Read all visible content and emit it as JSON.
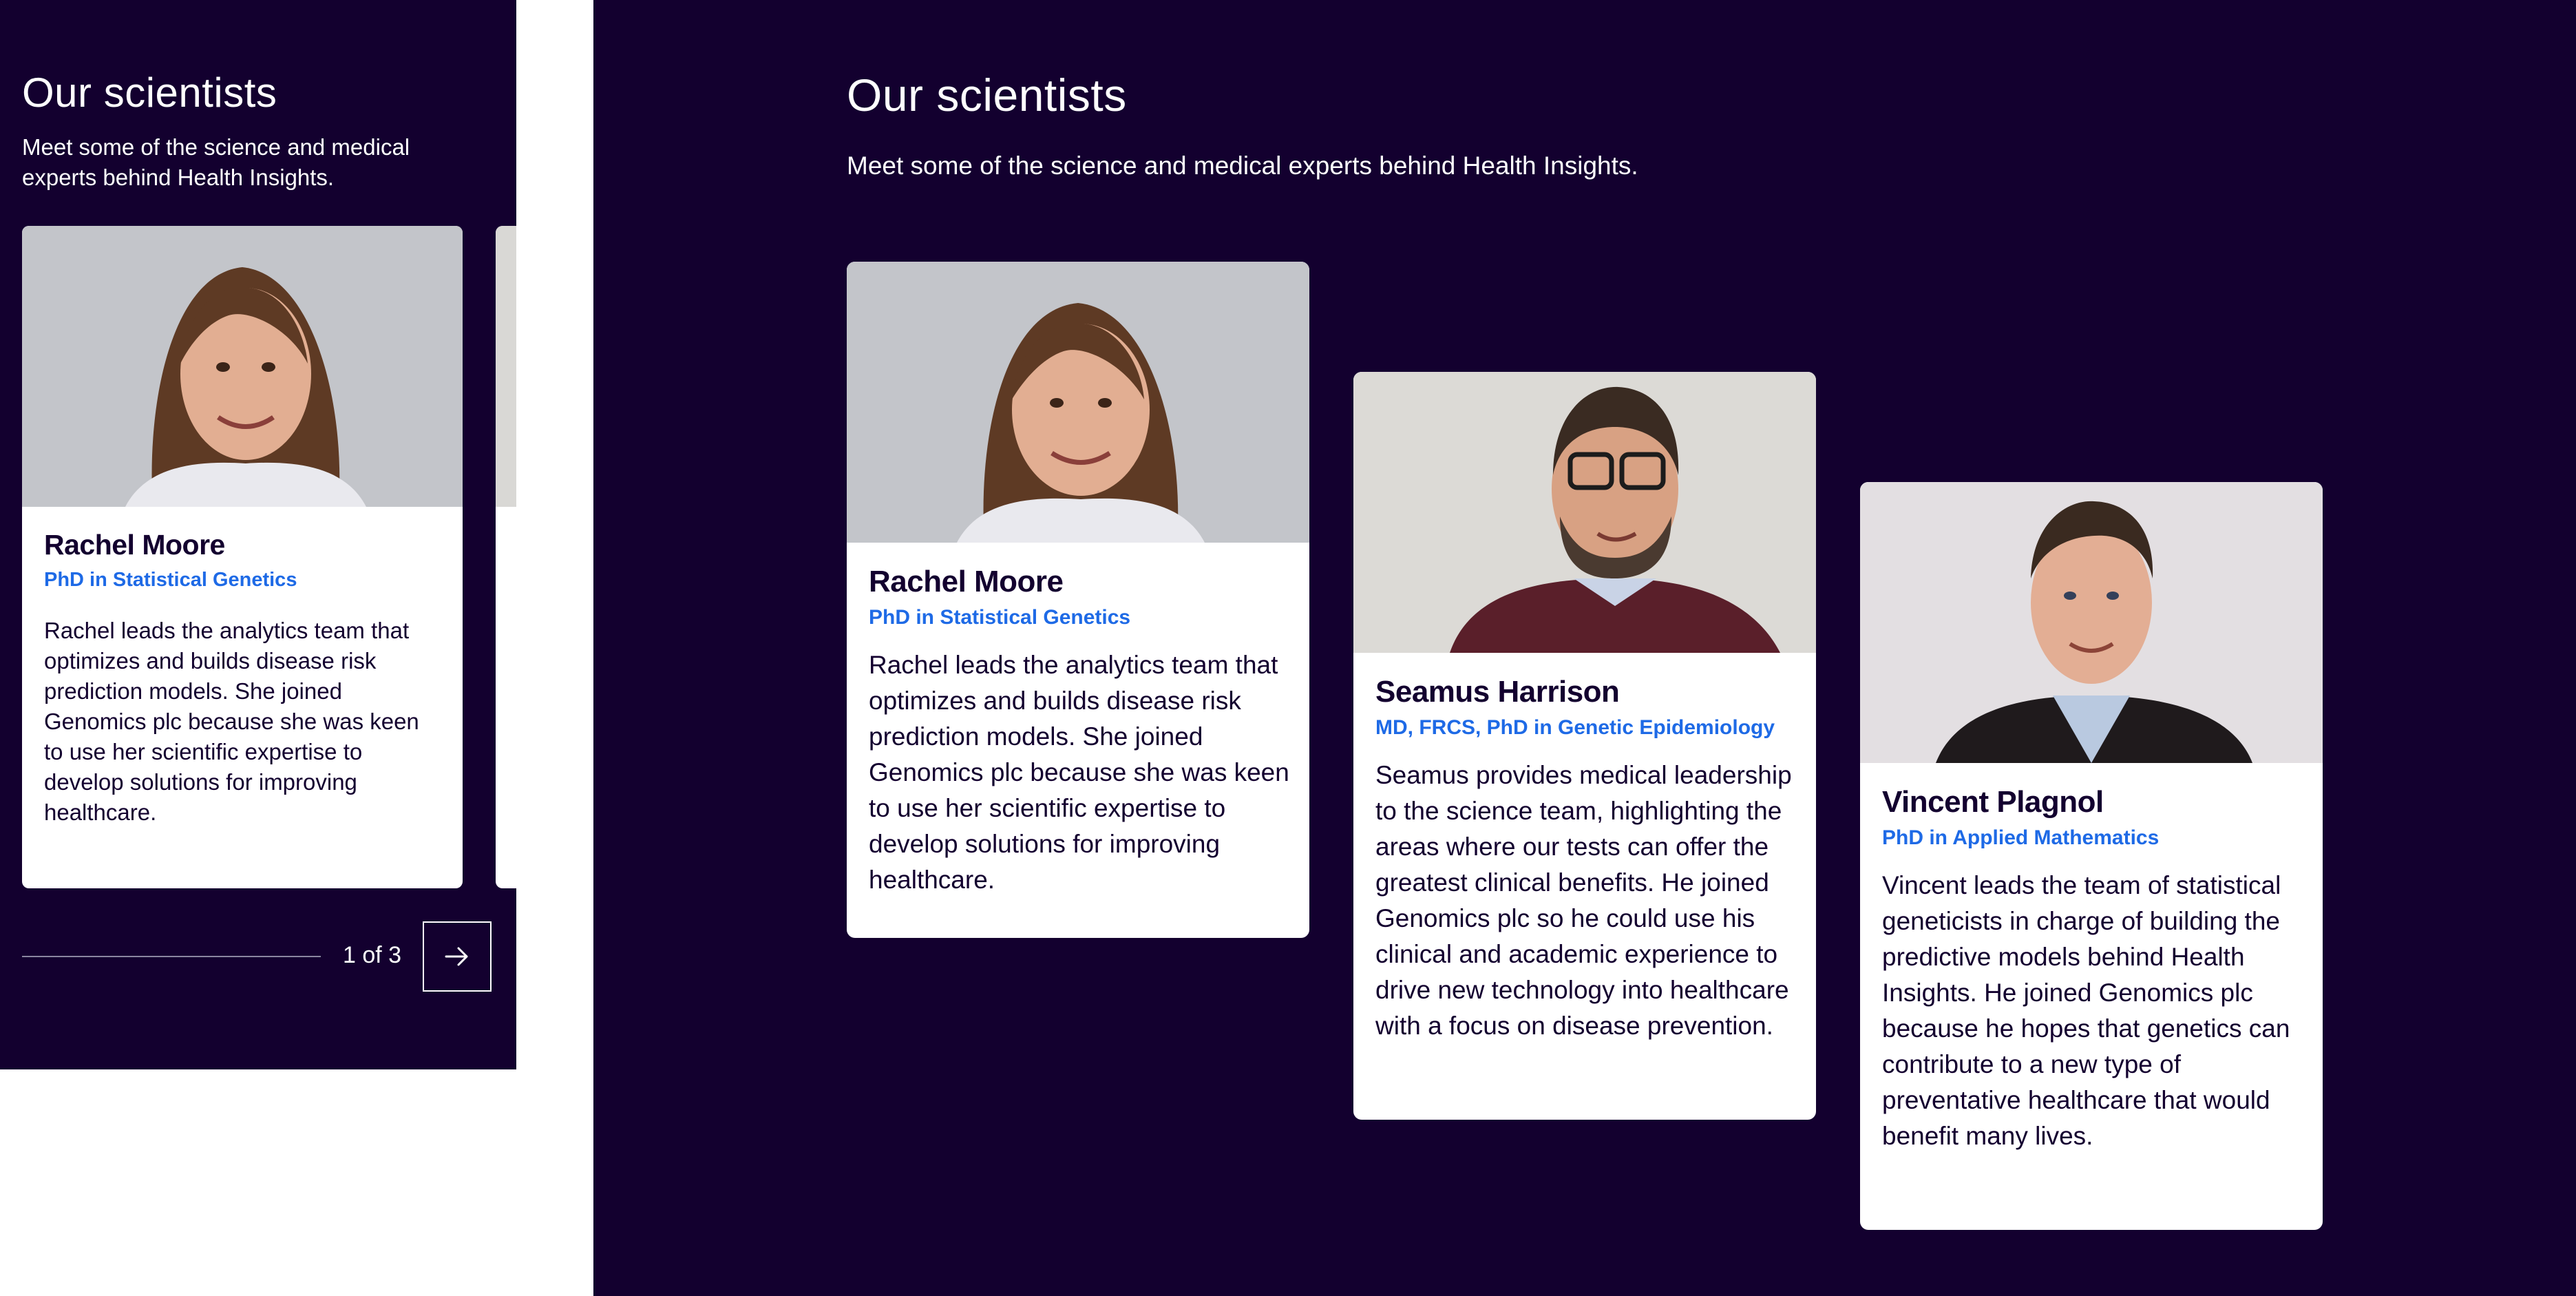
{
  "mobile": {
    "title": "Our scientists",
    "subtitle": "Meet some of the science and medical experts behind Health Insights.",
    "card": {
      "name": "Rachel Moore",
      "role": "PhD in Statistical Genetics",
      "bio": "Rachel leads the analytics team that optimizes and builds disease risk prediction models. She joined Genomics plc because she was keen to use her scientific expertise to develop solutions for improving healthcare."
    },
    "pagination": {
      "label": "1 of 3",
      "next_icon": "arrow-right-icon"
    }
  },
  "desktop": {
    "title": "Our scientists",
    "subtitle": "Meet some of the science and medical experts behind Health Insights.",
    "cards": [
      {
        "name": "Rachel Moore",
        "role": "PhD in Statistical Genetics",
        "bio": "Rachel leads the analytics team that optimizes and builds disease risk prediction models. She joined Genomics plc because she was keen to use her scientific expertise to develop solutions for improving healthcare."
      },
      {
        "name": "Seamus Harrison",
        "role": "MD, FRCS, PhD in Genetic Epidemiology",
        "bio": "Seamus provides medical leadership to the science team, highlighting the areas where our tests can offer the greatest clinical benefits. He joined Genomics plc so he could use his clinical and academic experience to drive new technology into healthcare with a focus on disease prevention."
      },
      {
        "name": "Vincent Plagnol",
        "role": "PhD in Applied Mathematics",
        "bio": "Vincent leads the team of statistical geneticists in charge of building the predictive models behind Health Insights. He joined Genomics plc because he hopes that genetics can contribute to a new type of preventative healthcare that would benefit many lives."
      }
    ]
  },
  "colors": {
    "background": "#13002f",
    "card": "#ffffff",
    "name_text": "#13002f",
    "role_text": "#1e6ae6",
    "body_text": "#13002f"
  }
}
